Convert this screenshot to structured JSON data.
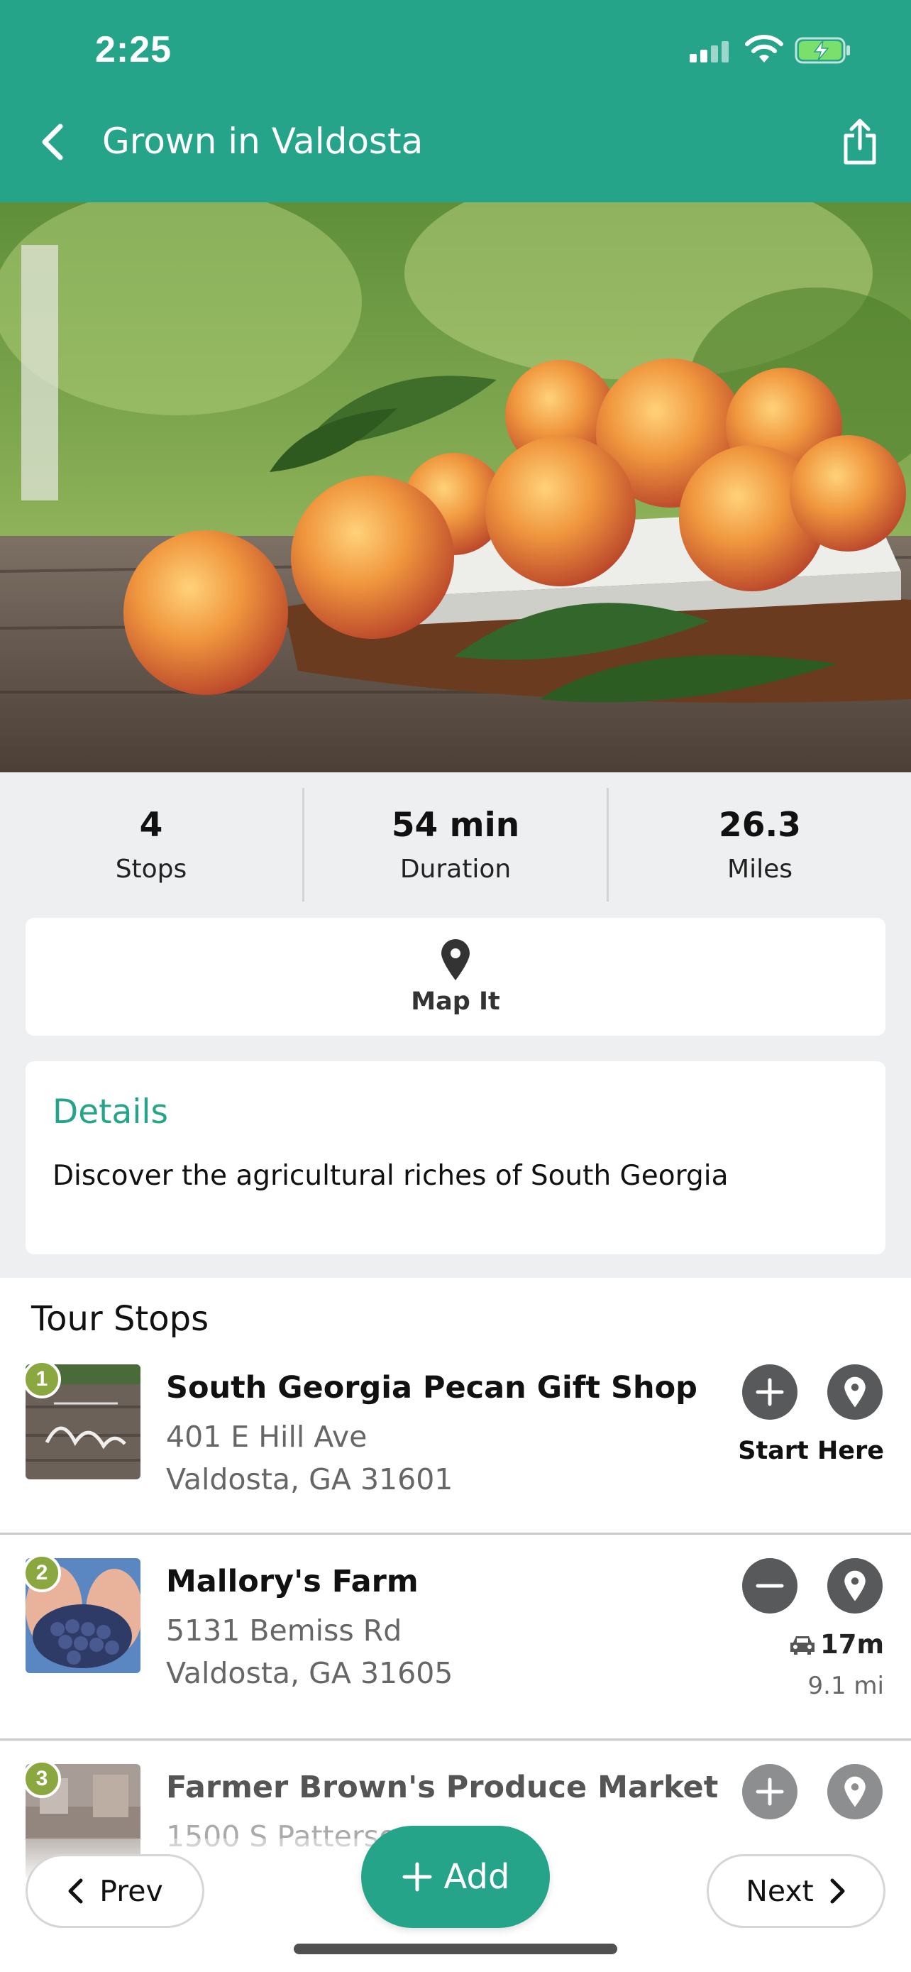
{
  "status_bar": {
    "time": "2:25"
  },
  "header": {
    "title": "Grown in Valdosta",
    "back_icon": "chevron-left-icon",
    "share_icon": "share-icon"
  },
  "hero": {
    "image": "peaches-photo"
  },
  "stats": [
    {
      "value": "4",
      "label": "Stops"
    },
    {
      "value": "54 min",
      "label": "Duration"
    },
    {
      "value": "26.3",
      "label": "Miles"
    }
  ],
  "map": {
    "label": "Map It",
    "icon": "map-pin-icon"
  },
  "details": {
    "title": "Details",
    "text": "Discover the agricultural riches of South Georgia"
  },
  "tour": {
    "title": "Tour Stops",
    "stops": [
      {
        "number": "1",
        "name": "South Georgia Pecan Gift Shop",
        "address1": "401 E Hill Ave",
        "address2": "Valdosta, GA 31601",
        "note": "Start Here",
        "action_icon": "plus-icon"
      },
      {
        "number": "2",
        "name": "Mallory's Farm",
        "address1": "5131 Bemiss Rd",
        "address2": "Valdosta, GA 31605",
        "drive_time": "17m",
        "drive_dist": "9.1 mi",
        "action_icon": "minus-icon"
      },
      {
        "number": "3",
        "name": "Farmer Brown's Produce Market",
        "address1": "1500 S Patterso",
        "action_icon": "plus-icon"
      }
    ]
  },
  "footer": {
    "prev_label": "Prev",
    "add_label": "Add",
    "next_label": "Next"
  },
  "colors": {
    "brand": "#26a489",
    "stop_badge": "#8aa83f",
    "action_btn": "#58595b"
  }
}
